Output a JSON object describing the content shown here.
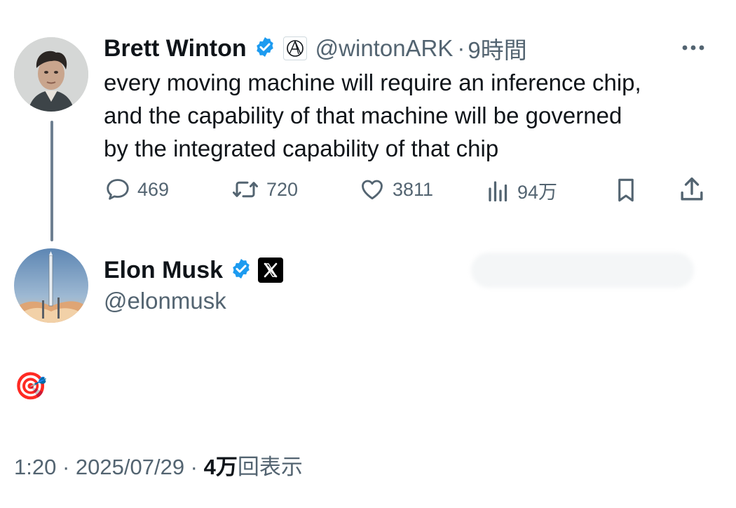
{
  "parent_tweet": {
    "author_name": "Brett Winton",
    "handle": "@wintonARK",
    "separator": "·",
    "time_ago": "9時間",
    "text_lines": [
      "every moving machine will require an inference chip,",
      "and the capability of that machine will be governed",
      "by the integrated capability of that chip"
    ],
    "stats": {
      "replies": "469",
      "reposts": "720",
      "likes": "3811",
      "views": "94万"
    }
  },
  "reply_tweet": {
    "author_name": "Elon Musk",
    "handle": "@elonmusk",
    "text": "🎯"
  },
  "footer": {
    "time": "1:20",
    "sep1": " · ",
    "date": "2025/07/29",
    "sep2": " · ",
    "views_count": "4万",
    "views_label": "回表示"
  },
  "colors": {
    "verified_blue": "#1d9bf0",
    "text_primary": "#0f1419",
    "text_secondary": "#536471",
    "thread_line": "#6e7f91"
  }
}
